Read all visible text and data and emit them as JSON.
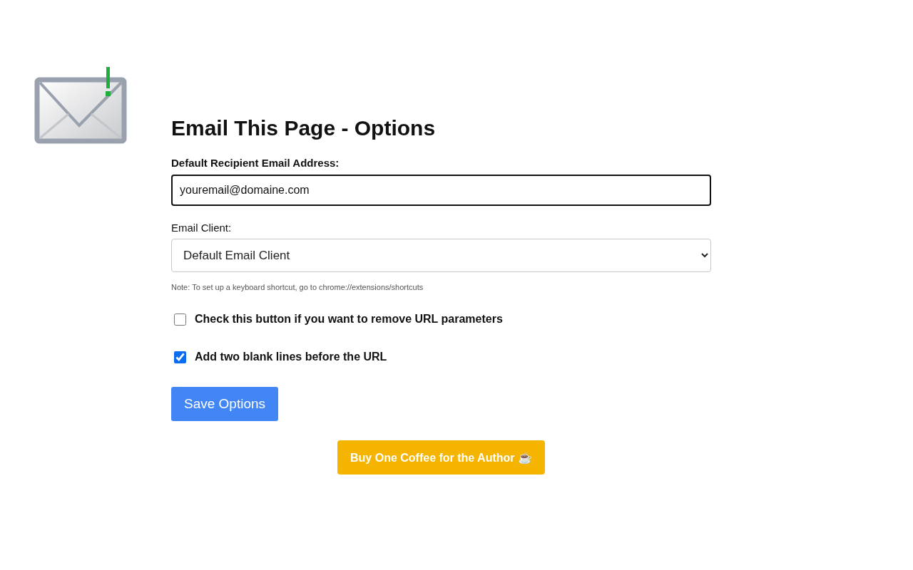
{
  "title": "Email This Page - Options",
  "recipient": {
    "label": "Default Recipient Email Address:",
    "value": "youremail@domaine.com"
  },
  "client": {
    "label": "Email Client:",
    "value": "Default Email Client"
  },
  "note": "Note: To set up a keyboard shortcut, go to chrome://extensions/shortcuts",
  "options": [
    {
      "label": "Check this button if you want to remove URL parameters",
      "checked": false
    },
    {
      "label": "Add two blank lines before the URL",
      "checked": true
    }
  ],
  "save_button": "Save Options",
  "coffee_button": "Buy One Coffee for the Author ☕"
}
